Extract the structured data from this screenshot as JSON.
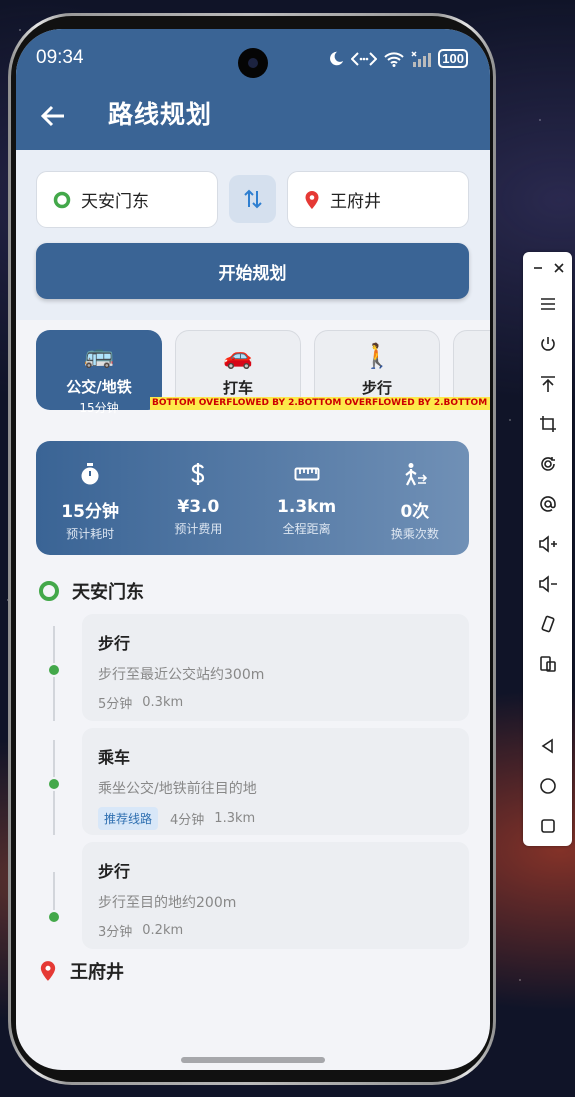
{
  "status": {
    "time": "09:34",
    "battery": "100"
  },
  "header": {
    "title": "路线规划"
  },
  "route": {
    "origin": "天安门东",
    "destination": "王府井",
    "start_button": "开始规划"
  },
  "modes": [
    {
      "emoji": "🚌",
      "label": "公交/地铁",
      "sub": "15分钟",
      "selected": true
    },
    {
      "emoji": "🚗",
      "label": "打车",
      "sub": "",
      "selected": false
    },
    {
      "emoji": "🚶",
      "label": "步行",
      "sub": "",
      "selected": false
    }
  ],
  "overflow_text": "BOTTOM OVERFLOWED BY 2.BOTTOM OVERFLOWED BY 2.BOTTOM OVERFLOWED BY 2.",
  "summary": [
    {
      "icon": "stopwatch-icon",
      "value": "15分钟",
      "caption": "预计耗时"
    },
    {
      "icon": "dollar-icon",
      "value": "¥3.0",
      "caption": "预计费用"
    },
    {
      "icon": "ruler-icon",
      "value": "1.3km",
      "caption": "全程距离"
    },
    {
      "icon": "transfer-icon",
      "value": "0次",
      "caption": "换乘次数"
    }
  ],
  "steps": [
    {
      "title": "步行",
      "desc": "步行至最近公交站约300m",
      "time": "5分钟",
      "dist": "0.3km",
      "badge": ""
    },
    {
      "title": "乘车",
      "desc": "乘坐公交/地铁前往目的地",
      "time": "4分钟",
      "dist": "1.3km",
      "badge": "推荐线路"
    },
    {
      "title": "步行",
      "desc": "步行至目的地约200m",
      "time": "3分钟",
      "dist": "0.2km",
      "badge": ""
    }
  ],
  "sidebar": [
    "minimize-icon",
    "close-icon",
    "menu-icon",
    "power-icon",
    "pin-top-icon",
    "crop-icon",
    "rotate-icon",
    "at-icon",
    "volume-up-icon",
    "volume-down-icon",
    "rotate-screen-icon",
    "multi-screen-icon",
    "back-nav-icon",
    "home-nav-icon",
    "recent-nav-icon"
  ],
  "colors": {
    "primary": "#3a6495",
    "accent_green": "#43a84a",
    "pin_red": "#e53935"
  }
}
